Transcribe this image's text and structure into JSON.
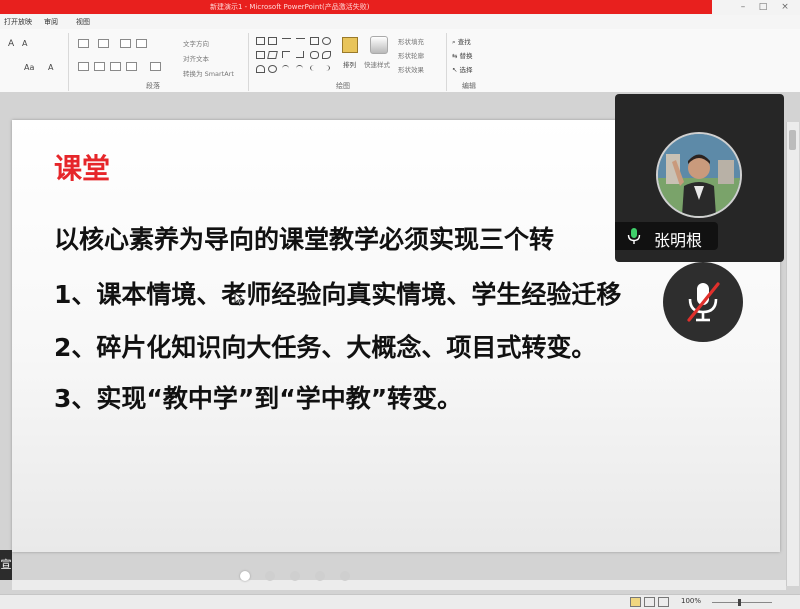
{
  "window": {
    "title": "新建演示1 - Microsoft PowerPoint(产品激活失败)"
  },
  "menu": {
    "tabs": [
      "打开放映",
      "审阅",
      "视图"
    ]
  },
  "ribbon": {
    "font_size_up": "A",
    "font_size_down": "A",
    "case_label": "Aa",
    "text_direction": "文字方向",
    "align_text": "对齐文本",
    "convert_smartart": "转换为 SmartArt",
    "paragraph_group": "段落",
    "arrange": "排列",
    "quick_styles": "快速样式",
    "shape_fill": "形状填充",
    "shape_outline": "形状轮廓",
    "shape_effects": "形状效果",
    "drawing_group": "绘图",
    "find": "查找",
    "replace": "替换",
    "select": "选择",
    "editing_group": "编辑"
  },
  "slide": {
    "title": "课堂",
    "lines": [
      "以核心素养为导向的课堂教学必须实现三个转",
      "1、课本情境、老师经验向真实情境、学生经验迁移",
      "2、碎片化知识向大任务、大概念、项目式转变。",
      "3、实现“教中学”到“学中教”转变。"
    ]
  },
  "sidebar": {
    "clipped_char": "宣"
  },
  "status": {
    "zoom": "100%"
  },
  "participant": {
    "name": "张明根",
    "mic": "on",
    "self_mic": "muted"
  },
  "colors": {
    "title_bar": "#e8201e",
    "slide_title": "#e6262a",
    "mic_green": "#3fcf6a",
    "mute_red": "#e0302c"
  }
}
